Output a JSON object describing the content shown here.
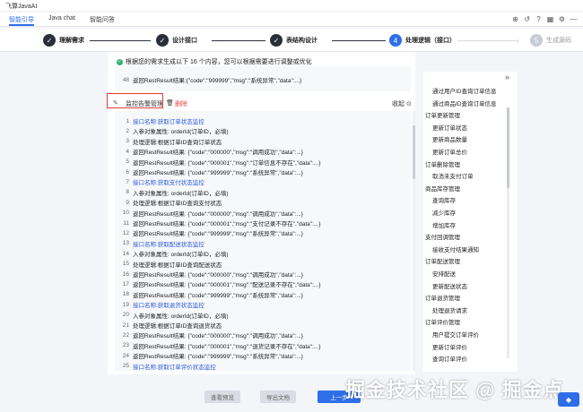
{
  "app": {
    "title": "飞算JavaAI"
  },
  "tabs": [
    {
      "label": "智能引导",
      "active": true
    },
    {
      "label": "Java chat",
      "active": false
    },
    {
      "label": "智能问答",
      "active": false
    }
  ],
  "toolbar_icons": [
    "add-icon",
    "history-icon",
    "help-icon",
    "calendar-icon",
    "settings-icon",
    "minimize-icon"
  ],
  "steps": [
    {
      "label": "理解需求",
      "state": "done",
      "mark": "✓"
    },
    {
      "label": "设计接口",
      "state": "done",
      "mark": "✓"
    },
    {
      "label": "表结构设计",
      "state": "done",
      "mark": "✓"
    },
    {
      "label": "处理逻辑（接口）",
      "state": "current",
      "mark": "4"
    },
    {
      "label": "生成源码",
      "state": "future",
      "mark": "5"
    }
  ],
  "notice": "根据您的需求生成以下 16 个内容，您可以根据需要进行调整或优化",
  "top_code": [
    {
      "no": "48",
      "text": "返回RestResult结果:{\"code\":\"999999\",\"msg\":\"系统异常\",\"data\":...}",
      "blue": false
    }
  ],
  "ops": {
    "edit": "监控告警管理",
    "delete": "删除",
    "collapse": "收起"
  },
  "code_lines": [
    {
      "no": "1",
      "text": "接口名称:获取订单状态监控",
      "blue": true
    },
    {
      "no": "2",
      "text": "入参对象属性: orderId(订单ID，必填)",
      "blue": false
    },
    {
      "no": "3",
      "text": "处理逻辑:根据订单ID查询订单状态",
      "blue": false
    },
    {
      "no": "4",
      "text": "返回RestResult结果: {\"code\":\"000000\",\"msg\":\"调用成功\",\"data\":...}",
      "blue": false
    },
    {
      "no": "5",
      "text": "返回RestResult结果: {\"code\":\"000001\",\"msg\":\"订单信息不存在\",\"data\":...}",
      "blue": false
    },
    {
      "no": "6",
      "text": "返回RestResult结果: {\"code\":\"999999\",\"msg\":\"系统异常\",\"data\":...}",
      "blue": false
    },
    {
      "no": "7",
      "text": "接口名称:获取支付状态监控",
      "blue": true
    },
    {
      "no": "8",
      "text": "入参对象属性: orderId(订单ID，必填)",
      "blue": false
    },
    {
      "no": "9",
      "text": "处理逻辑:根据订单ID查询支付状态",
      "blue": false
    },
    {
      "no": "10",
      "text": "返回RestResult结果: {\"code\":\"000000\",\"msg\":\"调用成功\",\"data\":...}",
      "blue": false
    },
    {
      "no": "11",
      "text": "返回RestResult结果: {\"code\":\"000001\",\"msg\":\"支付记录不存在\",\"data\":...}",
      "blue": false
    },
    {
      "no": "12",
      "text": "返回RestResult结果: {\"code\":\"999999\",\"msg\":\"系统异常\",\"data\":...}",
      "blue": false
    },
    {
      "no": "13",
      "text": "接口名称:获取配送状态监控",
      "blue": true
    },
    {
      "no": "14",
      "text": "入参对象属性: orderId(订单ID，必填)",
      "blue": false
    },
    {
      "no": "15",
      "text": "处理逻辑:根据订单ID查询配送状态",
      "blue": false
    },
    {
      "no": "16",
      "text": "返回RestResult结果: {\"code\":\"000000\",\"msg\":\"调用成功\",\"data\":...}",
      "blue": false
    },
    {
      "no": "17",
      "text": "返回RestResult结果: {\"code\":\"000001\",\"msg\":\"配送记录不存在\",\"data\":...}",
      "blue": false
    },
    {
      "no": "18",
      "text": "返回RestResult结果: {\"code\":\"999999\",\"msg\":\"系统异常\",\"data\":...}",
      "blue": false
    },
    {
      "no": "19",
      "text": "接口名称:获取退货状态监控",
      "blue": true
    },
    {
      "no": "20",
      "text": "入参对象属性: orderId(订单ID，必填)",
      "blue": false
    },
    {
      "no": "21",
      "text": "处理逻辑:根据订单ID查询退货状态",
      "blue": false
    },
    {
      "no": "22",
      "text": "返回RestResult结果: {\"code\":\"000000\",\"msg\":\"调用成功\",\"data\":...}",
      "blue": false
    },
    {
      "no": "23",
      "text": "返回RestResult结果: {\"code\":\"000001\",\"msg\":\"退货记录不存在\",\"data\":...}",
      "blue": false
    },
    {
      "no": "24",
      "text": "返回RestResult结果: {\"code\":\"999999\",\"msg\":\"系统异常\",\"data\":...}",
      "blue": false
    },
    {
      "no": "25",
      "text": "接口名称:获取订单评价状态监控",
      "blue": true
    }
  ],
  "side_items": [
    {
      "text": "通过用户ID查询订单信息",
      "indent": 1
    },
    {
      "text": "通过商品ID查询订单信息",
      "indent": 1
    },
    {
      "text": "订单更新管理",
      "indent": 0
    },
    {
      "text": "更新订单状态",
      "indent": 1
    },
    {
      "text": "更新商品数量",
      "indent": 1
    },
    {
      "text": "更新订单总价",
      "indent": 1
    },
    {
      "text": "订单删除管理",
      "indent": 0
    },
    {
      "text": "取消未支付订单",
      "indent": 1
    },
    {
      "text": "商品库存管理",
      "indent": 0
    },
    {
      "text": "查询库存",
      "indent": 1
    },
    {
      "text": "减少库存",
      "indent": 1
    },
    {
      "text": "增加库存",
      "indent": 1
    },
    {
      "text": "支付回调管理",
      "indent": 0
    },
    {
      "text": "接收支付结果通知",
      "indent": 1
    },
    {
      "text": "订单配送管理",
      "indent": 0
    },
    {
      "text": "安排配送",
      "indent": 1
    },
    {
      "text": "更新配送状态",
      "indent": 1
    },
    {
      "text": "订单退货管理",
      "indent": 0
    },
    {
      "text": "处理退货请求",
      "indent": 1
    },
    {
      "text": "订单评价管理",
      "indent": 0
    },
    {
      "text": "用户提交订单评价",
      "indent": 1
    },
    {
      "text": "更新订单评价",
      "indent": 1
    },
    {
      "text": "查询订单评价",
      "indent": 1
    }
  ],
  "footer": {
    "preview": "查看预览",
    "export": "导出文档",
    "prev": "上一步"
  },
  "watermark": "掘金技术社区 @ 掘金点"
}
